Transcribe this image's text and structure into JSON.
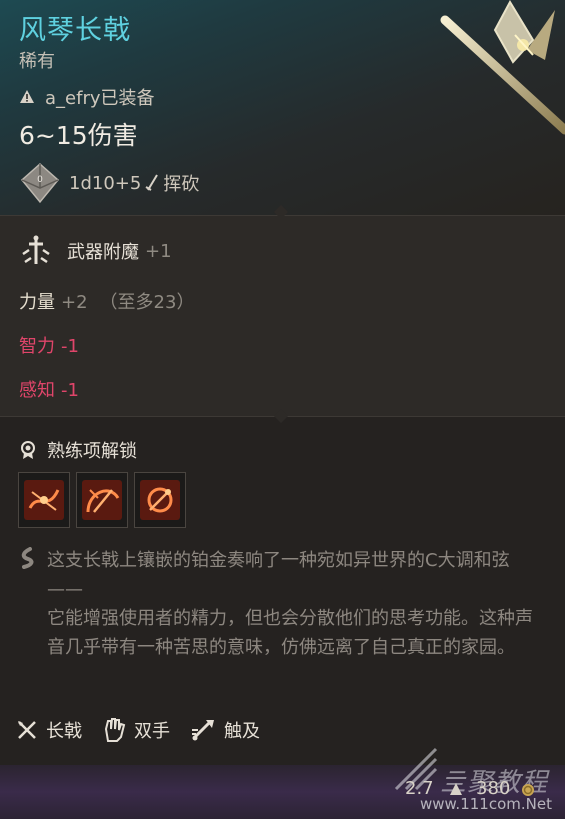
{
  "item": {
    "name": "风琴长戟",
    "rarity": "稀有",
    "equipped_by": "a_efry已装备",
    "damage": "6~15伤害",
    "dice_formula": "1d10+5",
    "damage_type": "挥砍"
  },
  "enchantment": {
    "label": "武器附魔",
    "value": "+1"
  },
  "stats": [
    {
      "name": "力量",
      "bonus": "+2",
      "cap": "（至多23）"
    },
    {
      "name": "智力",
      "bonus": "-1"
    },
    {
      "name": "感知",
      "bonus": "-1"
    }
  ],
  "proficiency": {
    "title": "熟练项解锁"
  },
  "lore": {
    "line1": "这支长戟上镶嵌的铂金奏响了一种宛如异世界的C大调和弦 ——",
    "line2": "它能增强使用者的精力，但也会分散他们的思考功能。这种声音几乎带有一种苦思的意味，仿佛远离了自己真正的家园。"
  },
  "tags": [
    {
      "icon": "halberd-icon",
      "label": "长戟"
    },
    {
      "icon": "two-hands-icon",
      "label": "双手"
    },
    {
      "icon": "reach-icon",
      "label": "触及"
    }
  ],
  "footer": {
    "weight": "2.7",
    "price": "380"
  },
  "watermark": {
    "text": "亖聚教程",
    "url": "www.111com.Net"
  },
  "colors": {
    "title": "#5fd1e0",
    "negative": "#e0456a",
    "panel": "#2d2a27"
  }
}
